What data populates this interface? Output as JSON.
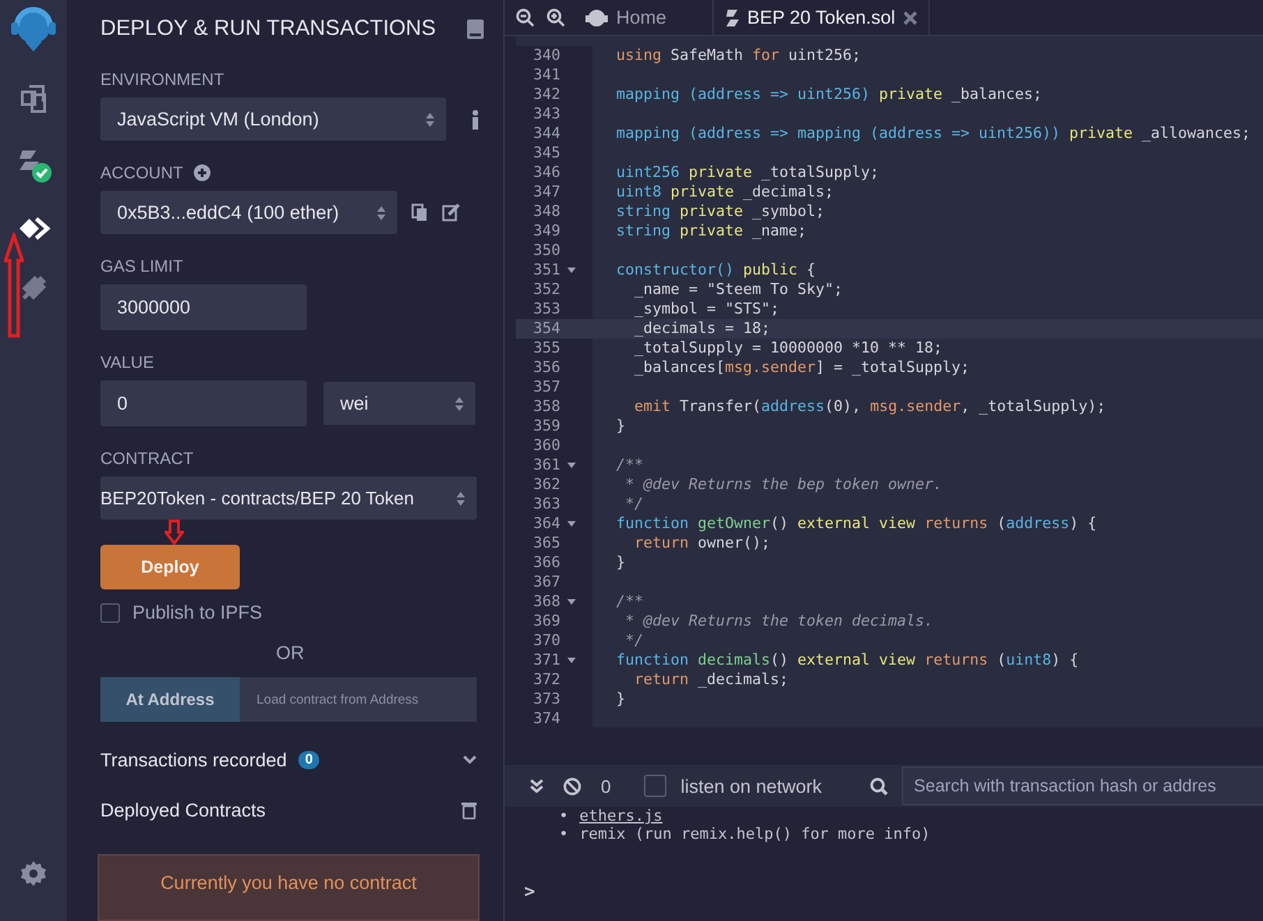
{
  "activity_bar": {
    "items": [
      {
        "kind": "files",
        "selected": false
      },
      {
        "kind": "compiler",
        "selected": false
      },
      {
        "kind": "deploy",
        "selected": true
      },
      {
        "kind": "debugger",
        "selected": false
      }
    ],
    "bottom": [
      {
        "kind": "settings",
        "selected": false
      }
    ]
  },
  "panel": {
    "title": "DEPLOY & RUN TRANSACTIONS",
    "environment": {
      "label": "ENVIRONMENT",
      "value": "JavaScript VM (London)"
    },
    "account": {
      "label": "ACCOUNT",
      "value": "0x5B3...eddC4 (100 ether)"
    },
    "gas_limit": {
      "label": "GAS LIMIT",
      "value": "3000000"
    },
    "value": {
      "label": "VALUE",
      "amount": "0",
      "unit": "wei"
    },
    "contract": {
      "label": "CONTRACT",
      "value": "BEP20Token - contracts/BEP 20 Token"
    },
    "deploy_button": "Deploy",
    "publish": {
      "label": "Publish to IPFS",
      "checked": false
    },
    "or": "OR",
    "at_address": {
      "button": "At Address",
      "placeholder": "Load contract from Address"
    },
    "transactions": {
      "label": "Transactions recorded",
      "count": "0"
    },
    "deployed": {
      "label": "Deployed Contracts"
    },
    "notice": "Currently you have no contract"
  },
  "editor": {
    "tabs": [
      {
        "label": "Home",
        "kind": "home",
        "selected": false
      },
      {
        "label": "BEP 20 Token.sol",
        "kind": "file",
        "selected": true
      }
    ],
    "lines": [
      {
        "num": "340",
        "tokens": [
          {
            "t": "  using",
            "kind": "kw"
          },
          {
            "t": " SafeMath ",
            "kind": "plain"
          },
          {
            "t": "for",
            "kind": "kw"
          },
          {
            "t": " uint256;",
            "kind": "plain"
          }
        ]
      },
      {
        "num": "341"
      },
      {
        "num": "342",
        "tokens": [
          {
            "t": "  mapping (address => uint256)",
            "kind": "type"
          },
          {
            "t": " private",
            "kind": "mod"
          },
          {
            "t": " _balances;",
            "kind": "plain"
          }
        ]
      },
      {
        "num": "343"
      },
      {
        "num": "344",
        "tokens": [
          {
            "t": "  mapping (address => mapping (address => uint256))",
            "kind": "type"
          },
          {
            "t": " private",
            "kind": "mod"
          },
          {
            "t": " _allowances;",
            "kind": "plain"
          }
        ]
      },
      {
        "num": "345"
      },
      {
        "num": "346",
        "tokens": [
          {
            "t": "  uint256",
            "kind": "type"
          },
          {
            "t": " private",
            "kind": "mod"
          },
          {
            "t": " _totalSupply;",
            "kind": "plain"
          }
        ]
      },
      {
        "num": "347",
        "tokens": [
          {
            "t": "  uint8",
            "kind": "type"
          },
          {
            "t": " private",
            "kind": "mod"
          },
          {
            "t": " _decimals;",
            "kind": "plain"
          }
        ]
      },
      {
        "num": "348",
        "tokens": [
          {
            "t": "  string",
            "kind": "type"
          },
          {
            "t": " private",
            "kind": "mod"
          },
          {
            "t": " _symbol;",
            "kind": "plain"
          }
        ]
      },
      {
        "num": "349",
        "tokens": [
          {
            "t": "  string",
            "kind": "type"
          },
          {
            "t": " private",
            "kind": "mod"
          },
          {
            "t": " _name;",
            "kind": "plain"
          }
        ]
      },
      {
        "num": "350"
      },
      {
        "num": "351",
        "fold": true,
        "tokens": [
          {
            "t": "  constructor()",
            "kind": "type"
          },
          {
            "t": " public",
            "kind": "mod"
          },
          {
            "t": " {",
            "kind": "plain"
          }
        ]
      },
      {
        "num": "352",
        "tokens": [
          {
            "t": "    _name = \"Steem To Sky\";",
            "kind": "plain"
          }
        ]
      },
      {
        "num": "353",
        "tokens": [
          {
            "t": "    _symbol = \"STS\";",
            "kind": "plain"
          }
        ]
      },
      {
        "num": "354",
        "current": true,
        "tokens": [
          {
            "t": "    _decimals = 18;",
            "kind": "plain"
          }
        ]
      },
      {
        "num": "355",
        "tokens": [
          {
            "t": "    _totalSupply = 10000000 *10 ** 18;",
            "kind": "plain"
          }
        ]
      },
      {
        "num": "356",
        "tokens": [
          {
            "t": "    _balances[",
            "kind": "plain"
          },
          {
            "t": "msg.sender",
            "kind": "kw"
          },
          {
            "t": "] = _totalSupply;",
            "kind": "plain"
          }
        ]
      },
      {
        "num": "357"
      },
      {
        "num": "358",
        "tokens": [
          {
            "t": "    emit",
            "kind": "kw"
          },
          {
            "t": " Transfer(",
            "kind": "plain"
          },
          {
            "t": "address",
            "kind": "type"
          },
          {
            "t": "(0), ",
            "kind": "plain"
          },
          {
            "t": "msg.sender",
            "kind": "kw"
          },
          {
            "t": ", _totalSupply);",
            "kind": "plain"
          }
        ]
      },
      {
        "num": "359",
        "tokens": [
          {
            "t": "  }",
            "kind": "plain"
          }
        ]
      },
      {
        "num": "360"
      },
      {
        "num": "361",
        "fold": true,
        "tokens": [
          {
            "t": "  /**",
            "kind": "comment"
          }
        ]
      },
      {
        "num": "362",
        "tokens": [
          {
            "t": "   * @dev Returns the bep token owner.",
            "kind": "comment"
          }
        ]
      },
      {
        "num": "363",
        "tokens": [
          {
            "t": "   */",
            "kind": "comment"
          }
        ]
      },
      {
        "num": "364",
        "fold": true,
        "tokens": [
          {
            "t": "  function",
            "kind": "type"
          },
          {
            "t": " getOwner",
            "kind": "fn"
          },
          {
            "t": "() ",
            "kind": "plain"
          },
          {
            "t": "external view",
            "kind": "mod"
          },
          {
            "t": " returns",
            "kind": "kw"
          },
          {
            "t": " (",
            "kind": "plain"
          },
          {
            "t": "address",
            "kind": "type"
          },
          {
            "t": ") {",
            "kind": "plain"
          }
        ]
      },
      {
        "num": "365",
        "tokens": [
          {
            "t": "    return",
            "kind": "kw"
          },
          {
            "t": " owner();",
            "kind": "plain"
          }
        ]
      },
      {
        "num": "366",
        "tokens": [
          {
            "t": "  }",
            "kind": "plain"
          }
        ]
      },
      {
        "num": "367"
      },
      {
        "num": "368",
        "fold": true,
        "tokens": [
          {
            "t": "  /**",
            "kind": "comment"
          }
        ]
      },
      {
        "num": "369",
        "tokens": [
          {
            "t": "   * @dev Returns the token decimals.",
            "kind": "comment"
          }
        ]
      },
      {
        "num": "370",
        "tokens": [
          {
            "t": "   */",
            "kind": "comment"
          }
        ]
      },
      {
        "num": "371",
        "fold": true,
        "tokens": [
          {
            "t": "  function",
            "kind": "type"
          },
          {
            "t": " decimals",
            "kind": "fn"
          },
          {
            "t": "() ",
            "kind": "plain"
          },
          {
            "t": "external view",
            "kind": "mod"
          },
          {
            "t": " returns",
            "kind": "kw"
          },
          {
            "t": " (",
            "kind": "plain"
          },
          {
            "t": "uint8",
            "kind": "type"
          },
          {
            "t": ") {",
            "kind": "plain"
          }
        ]
      },
      {
        "num": "372",
        "tokens": [
          {
            "t": "    return",
            "kind": "kw"
          },
          {
            "t": " _decimals;",
            "kind": "plain"
          }
        ]
      },
      {
        "num": "373",
        "tokens": [
          {
            "t": "  }",
            "kind": "plain"
          }
        ]
      },
      {
        "num": "374"
      }
    ]
  },
  "terminal": {
    "count": "0",
    "listen": {
      "label": "listen on network",
      "checked": false
    },
    "search_placeholder": "Search with transaction hash or addres",
    "output": [
      {
        "bullet": "•",
        "text": "ethers.js",
        "link": true
      },
      {
        "bullet": "•",
        "text": "remix (run remix.help() for more info)",
        "link": false
      }
    ],
    "prompt": ">"
  }
}
